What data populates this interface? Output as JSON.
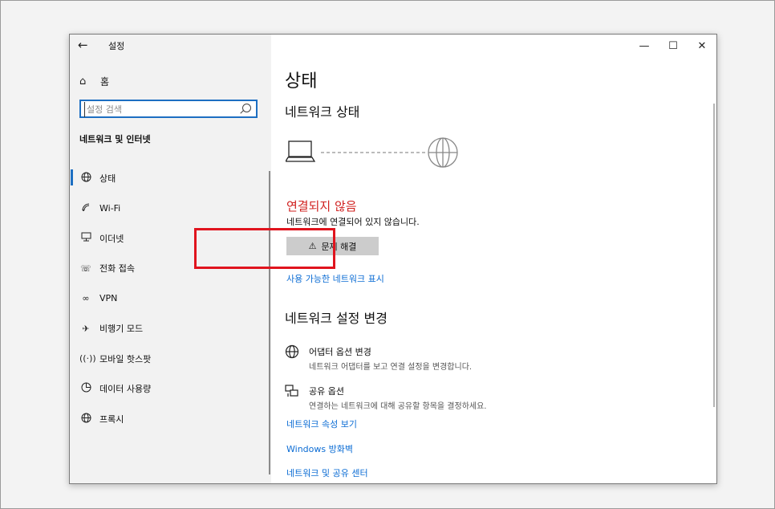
{
  "window": {
    "title": "설정",
    "controls": {
      "minimize": "—",
      "maximize": "☐",
      "close": "✕"
    }
  },
  "sidebar": {
    "home_label": "홈",
    "search_placeholder": "설정 검색",
    "section_title": "네트워크 및 인터넷",
    "items": [
      {
        "label": "상태",
        "icon": "globe-icon",
        "selected": true
      },
      {
        "label": "Wi-Fi",
        "icon": "wifi-icon",
        "selected": false
      },
      {
        "label": "이더넷",
        "icon": "ethernet-icon",
        "selected": false
      },
      {
        "label": "전화 접속",
        "icon": "dialup-icon",
        "selected": false
      },
      {
        "label": "VPN",
        "icon": "vpn-icon",
        "selected": false
      },
      {
        "label": "비행기 모드",
        "icon": "airplane-icon",
        "selected": false
      },
      {
        "label": "모바일 핫스팟",
        "icon": "hotspot-icon",
        "selected": false
      },
      {
        "label": "데이터 사용량",
        "icon": "data-usage-icon",
        "selected": false
      },
      {
        "label": "프록시",
        "icon": "proxy-icon",
        "selected": false
      }
    ]
  },
  "main": {
    "page_title": "상태",
    "network_status_title": "네트워크 상태",
    "status": "연결되지 않음",
    "status_description": "네트워크에 연결되어 있지 않습니다.",
    "troubleshoot_label": "문제 해결",
    "show_networks_link": "사용 가능한 네트워크 표시",
    "change_settings_title": "네트워크 설정 변경",
    "options": [
      {
        "title": "어댑터 옵션 변경",
        "description": "네트워크 어댑터를 보고 연결 설정을 변경합니다.",
        "icon": "adapter-icon"
      },
      {
        "title": "공유 옵션",
        "description": "연결하는 네트워크에 대해 공유할 항목을 결정하세요.",
        "icon": "sharing-icon"
      }
    ],
    "links": {
      "properties": "네트워크 속성 보기",
      "firewall": "Windows 방화벽",
      "sharing_center": "네트워크 및 공유 센터"
    }
  },
  "colors": {
    "accent": "#1d6fc2",
    "link": "#0b6cd4",
    "error": "#d0201f",
    "highlight": "#e0141e"
  }
}
